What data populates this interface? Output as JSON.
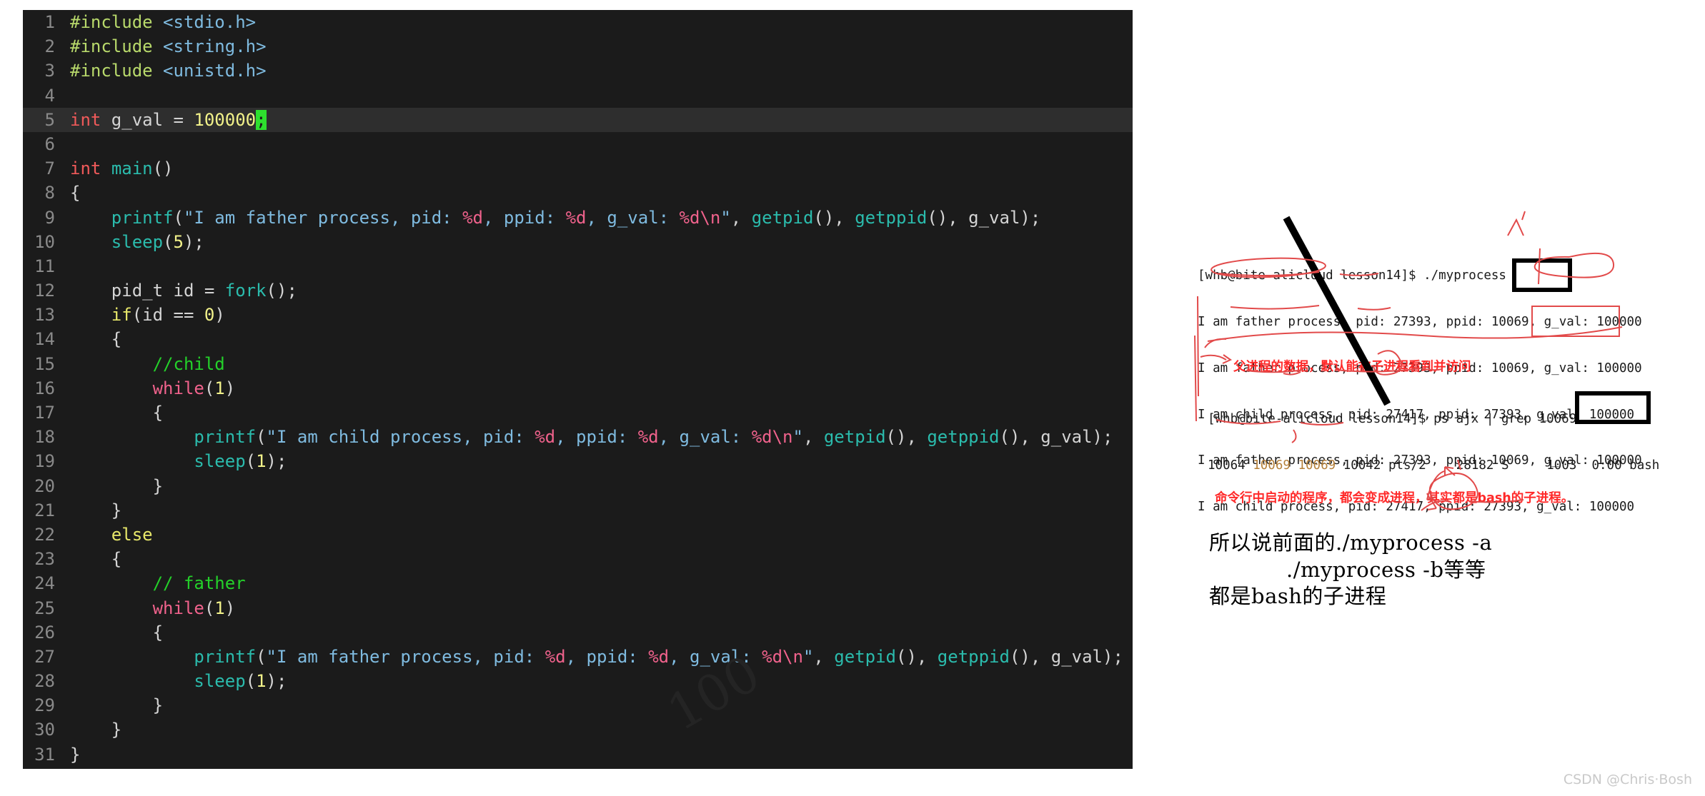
{
  "editor": {
    "name": "code-editor",
    "theme_bg": "#1b1b1b",
    "highlight_line": 5,
    "lines": [
      {
        "n": "1",
        "tokens": [
          {
            "t": "#include ",
            "c": "inc"
          },
          {
            "t": "<stdio.h>",
            "c": "hdr"
          }
        ]
      },
      {
        "n": "2",
        "tokens": [
          {
            "t": "#include ",
            "c": "inc"
          },
          {
            "t": "<string.h>",
            "c": "hdr"
          }
        ]
      },
      {
        "n": "3",
        "tokens": [
          {
            "t": "#include ",
            "c": "inc"
          },
          {
            "t": "<unistd.h>",
            "c": "hdr"
          }
        ]
      },
      {
        "n": "4",
        "tokens": []
      },
      {
        "n": "5",
        "tokens": [
          {
            "t": "int",
            "c": "def"
          },
          {
            "t": " g_val = ",
            "c": "pl"
          },
          {
            "t": "100000",
            "c": "num"
          },
          {
            "t": ";",
            "c": "cursor"
          }
        ]
      },
      {
        "n": "6",
        "tokens": []
      },
      {
        "n": "7",
        "tokens": [
          {
            "t": "int",
            "c": "def"
          },
          {
            "t": " ",
            "c": "pl"
          },
          {
            "t": "main",
            "c": "fn"
          },
          {
            "t": "()",
            "c": "pl"
          }
        ]
      },
      {
        "n": "8",
        "tokens": [
          {
            "t": "{",
            "c": "pl"
          }
        ]
      },
      {
        "n": "9",
        "tokens": [
          {
            "t": "    ",
            "c": "pl"
          },
          {
            "t": "printf",
            "c": "fn"
          },
          {
            "t": "(",
            "c": "pl"
          },
          {
            "t": "\"I am father process, pid: ",
            "c": "str"
          },
          {
            "t": "%d",
            "c": "fmt"
          },
          {
            "t": ", ppid: ",
            "c": "str"
          },
          {
            "t": "%d",
            "c": "fmt"
          },
          {
            "t": ", g_val: ",
            "c": "str"
          },
          {
            "t": "%d\\n",
            "c": "fmt"
          },
          {
            "t": "\"",
            "c": "str"
          },
          {
            "t": ", ",
            "c": "pl"
          },
          {
            "t": "getpid",
            "c": "fn"
          },
          {
            "t": "(), ",
            "c": "pl"
          },
          {
            "t": "getppid",
            "c": "fn"
          },
          {
            "t": "(), g_val);",
            "c": "pl"
          }
        ]
      },
      {
        "n": "10",
        "tokens": [
          {
            "t": "    ",
            "c": "pl"
          },
          {
            "t": "sleep",
            "c": "fn"
          },
          {
            "t": "(",
            "c": "pl"
          },
          {
            "t": "5",
            "c": "num"
          },
          {
            "t": ");",
            "c": "pl"
          }
        ]
      },
      {
        "n": "11",
        "tokens": []
      },
      {
        "n": "12",
        "tokens": [
          {
            "t": "    pid_t id = ",
            "c": "pl"
          },
          {
            "t": "fork",
            "c": "fn"
          },
          {
            "t": "();",
            "c": "pl"
          }
        ]
      },
      {
        "n": "13",
        "tokens": [
          {
            "t": "    ",
            "c": "pl"
          },
          {
            "t": "if",
            "c": "kw"
          },
          {
            "t": "(id == ",
            "c": "pl"
          },
          {
            "t": "0",
            "c": "num"
          },
          {
            "t": ")",
            "c": "pl"
          }
        ]
      },
      {
        "n": "14",
        "tokens": [
          {
            "t": "    {",
            "c": "pl"
          }
        ]
      },
      {
        "n": "15",
        "tokens": [
          {
            "t": "        ",
            "c": "pl"
          },
          {
            "t": "//child",
            "c": "com"
          }
        ]
      },
      {
        "n": "16",
        "tokens": [
          {
            "t": "        ",
            "c": "pl"
          },
          {
            "t": "while",
            "c": "kwr"
          },
          {
            "t": "(",
            "c": "pl"
          },
          {
            "t": "1",
            "c": "num"
          },
          {
            "t": ")",
            "c": "pl"
          }
        ]
      },
      {
        "n": "17",
        "tokens": [
          {
            "t": "        {",
            "c": "pl"
          }
        ]
      },
      {
        "n": "18",
        "tokens": [
          {
            "t": "            ",
            "c": "pl"
          },
          {
            "t": "printf",
            "c": "fn"
          },
          {
            "t": "(",
            "c": "pl"
          },
          {
            "t": "\"I am child process, pid: ",
            "c": "str"
          },
          {
            "t": "%d",
            "c": "fmt"
          },
          {
            "t": ", ppid: ",
            "c": "str"
          },
          {
            "t": "%d",
            "c": "fmt"
          },
          {
            "t": ", g_val: ",
            "c": "str"
          },
          {
            "t": "%d\\n",
            "c": "fmt"
          },
          {
            "t": "\"",
            "c": "str"
          },
          {
            "t": ", ",
            "c": "pl"
          },
          {
            "t": "getpid",
            "c": "fn"
          },
          {
            "t": "(), ",
            "c": "pl"
          },
          {
            "t": "getppid",
            "c": "fn"
          },
          {
            "t": "(), g_val);",
            "c": "pl"
          }
        ]
      },
      {
        "n": "19",
        "tokens": [
          {
            "t": "            ",
            "c": "pl"
          },
          {
            "t": "sleep",
            "c": "fn"
          },
          {
            "t": "(",
            "c": "pl"
          },
          {
            "t": "1",
            "c": "num"
          },
          {
            "t": ");",
            "c": "pl"
          }
        ]
      },
      {
        "n": "20",
        "tokens": [
          {
            "t": "        }",
            "c": "pl"
          }
        ]
      },
      {
        "n": "21",
        "tokens": [
          {
            "t": "    }",
            "c": "pl"
          }
        ]
      },
      {
        "n": "22",
        "tokens": [
          {
            "t": "    ",
            "c": "pl"
          },
          {
            "t": "else",
            "c": "kw"
          }
        ]
      },
      {
        "n": "23",
        "tokens": [
          {
            "t": "    {",
            "c": "pl"
          }
        ]
      },
      {
        "n": "24",
        "tokens": [
          {
            "t": "        ",
            "c": "pl"
          },
          {
            "t": "// father",
            "c": "com"
          }
        ]
      },
      {
        "n": "25",
        "tokens": [
          {
            "t": "        ",
            "c": "pl"
          },
          {
            "t": "while",
            "c": "kwr"
          },
          {
            "t": "(",
            "c": "pl"
          },
          {
            "t": "1",
            "c": "num"
          },
          {
            "t": ")",
            "c": "pl"
          }
        ]
      },
      {
        "n": "26",
        "tokens": [
          {
            "t": "        {",
            "c": "pl"
          }
        ]
      },
      {
        "n": "27",
        "tokens": [
          {
            "t": "            ",
            "c": "pl"
          },
          {
            "t": "printf",
            "c": "fn"
          },
          {
            "t": "(",
            "c": "pl"
          },
          {
            "t": "\"I am father process, pid: ",
            "c": "str"
          },
          {
            "t": "%d",
            "c": "fmt"
          },
          {
            "t": ", ppid: ",
            "c": "str"
          },
          {
            "t": "%d",
            "c": "fmt"
          },
          {
            "t": ", g_val: ",
            "c": "str"
          },
          {
            "t": "%d\\n",
            "c": "fmt"
          },
          {
            "t": "\"",
            "c": "str"
          },
          {
            "t": ", ",
            "c": "pl"
          },
          {
            "t": "getpid",
            "c": "fn"
          },
          {
            "t": "(), ",
            "c": "pl"
          },
          {
            "t": "getppid",
            "c": "fn"
          },
          {
            "t": "(), g_val);",
            "c": "pl"
          }
        ]
      },
      {
        "n": "28",
        "tokens": [
          {
            "t": "            ",
            "c": "pl"
          },
          {
            "t": "sleep",
            "c": "fn"
          },
          {
            "t": "(",
            "c": "pl"
          },
          {
            "t": "1",
            "c": "num"
          },
          {
            "t": ");",
            "c": "pl"
          }
        ]
      },
      {
        "n": "29",
        "tokens": [
          {
            "t": "        }",
            "c": "pl"
          }
        ]
      },
      {
        "n": "30",
        "tokens": [
          {
            "t": "    }",
            "c": "pl"
          }
        ]
      },
      {
        "n": "31",
        "tokens": [
          {
            "t": "}",
            "c": "pl"
          }
        ]
      }
    ],
    "watermark_faint": "100"
  },
  "terminal_top": {
    "prompt_line": "[whb@bite-alicloud lesson14]$ ./myprocess",
    "lines": [
      "I am father process, pid: 27393, ppid: 10069, g_val: 100000",
      "I am father process, pid: 27393, ppid: 10069, g_val: 100000",
      "I am child process, pid: 27417, ppid: 27393, g_val: 100000",
      "I am father process, pid: 27393, ppid: 10069, g_val: 100000",
      "I am child process, pid: 27417, ppid: 27393, g_val: 100000"
    ]
  },
  "terminal_bottom": {
    "prompt_line": "[whb@bite-alicloud lesson14]$ ps ajx | grep 10069",
    "ps_row": {
      "ppid": "10064",
      "pid": "10069",
      "pgid": "10069",
      "sid": "10042",
      "tty": "pts/2",
      "tpgid": "28182",
      "stat": "S",
      "uid": "1003",
      "time_cmd": "0:00 bash",
      "full": "10064 10069 10069 10042 pts/2    28182 S     1003  0:00 bash"
    }
  },
  "annotations": {
    "note_parent_data": "父进程的数据，默认能被子进程看到并访问",
    "note_bash_child": "命令行中启动的程序，都会变成进程，其实都是bash的子进程。",
    "conclusion_line1": "所以说前面的./myprocess -a",
    "conclusion_line2": "./myprocess -b等等",
    "conclusion_line3": "都是bash的子进程",
    "colors": {
      "red": "#ff2a2a",
      "black": "#000000",
      "highlight_pid": "#b5803a"
    }
  },
  "watermark": {
    "text": "CSDN @Chris·Bosh"
  }
}
